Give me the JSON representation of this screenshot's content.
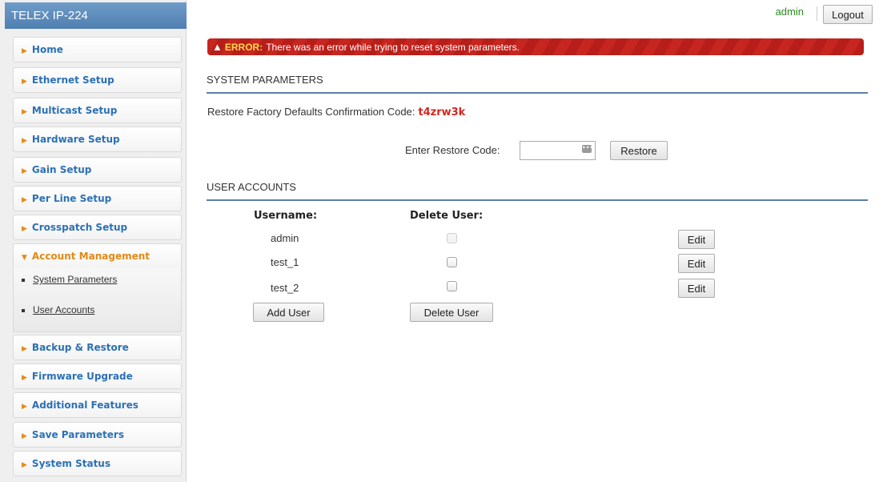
{
  "app": {
    "title": "TELEX IP-224"
  },
  "sidebar": {
    "items": [
      {
        "label": "Home"
      },
      {
        "label": "Ethernet Setup"
      },
      {
        "label": "Multicast Setup"
      },
      {
        "label": "Hardware Setup"
      },
      {
        "label": "Gain Setup"
      },
      {
        "label": "Per Line Setup"
      },
      {
        "label": "Crosspatch Setup"
      },
      {
        "label": "Account Management",
        "active": true
      },
      {
        "label": "Backup & Restore"
      },
      {
        "label": "Firmware Upgrade"
      },
      {
        "label": "Additional Features"
      },
      {
        "label": "Save Parameters"
      },
      {
        "label": "System Status"
      }
    ],
    "submenu": [
      {
        "label": "System Parameters"
      },
      {
        "label": "User Accounts"
      }
    ]
  },
  "header": {
    "user": "admin",
    "logout_label": "Logout"
  },
  "error": {
    "label": "ERROR:",
    "message": "There was an error while trying to reset system parameters."
  },
  "system_parameters": {
    "title": "SYSTEM PARAMETERS",
    "confirmation_label": "Restore Factory Defaults Confirmation Code:",
    "confirmation_code": "t4zrw3k",
    "enter_label": "Enter Restore Code:",
    "restore_value": "",
    "restore_button": "Restore"
  },
  "user_accounts": {
    "title": "USER ACCOUNTS",
    "username_header": "Username:",
    "delete_header": "Delete User:",
    "rows": [
      {
        "username": "admin",
        "edit_label": "Edit",
        "delete_disabled": true
      },
      {
        "username": "test_1",
        "edit_label": "Edit",
        "delete_disabled": false
      },
      {
        "username": "test_2",
        "edit_label": "Edit",
        "delete_disabled": false
      }
    ],
    "add_user_label": "Add User",
    "delete_user_label": "Delete User"
  },
  "colors": {
    "brand": "#5a88b8",
    "nav_text": "#2c70b5",
    "active": "#e08a16",
    "error": "#c72520",
    "code": "#d42620",
    "user": "#2a8a1f"
  }
}
